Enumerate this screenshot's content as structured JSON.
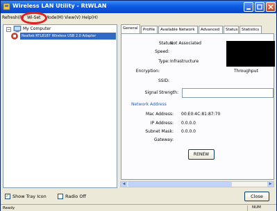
{
  "window": {
    "title": "Wireless LAN Utility - RtWLAN"
  },
  "menu": {
    "items": [
      "Refresh(R)",
      "Wi-Set",
      "Mode(M)",
      "View(V)",
      "Help(H)"
    ]
  },
  "tree": {
    "root_label": "My Computer",
    "adapter_label": "Realtek RTL8187 Wireless USB 2.0 Adapter"
  },
  "tabs": [
    "General",
    "Profile",
    "Available Network",
    "Advanced",
    "Status",
    "Statistics"
  ],
  "general": {
    "status_label": "Status:",
    "status_value": "Not Associated",
    "speed_label": "Speed:",
    "speed_value": "",
    "type_label": "Type:",
    "type_value": "Infrastructure",
    "encryption_label": "Encryption:",
    "encryption_value": "",
    "throughput_label": "Throughput",
    "ssid_label": "SSID:",
    "ssid_value": "",
    "signal_label": "Signal Strength:",
    "network_section": "Network Address",
    "mac_label": "Mac Address:",
    "mac_value": "00:E0:4C:81:87:70",
    "ip_label": "IP Address:",
    "ip_value": "0.0.0.0",
    "subnet_label": "Subnet Mask:",
    "subnet_value": "0.0.0.0",
    "gateway_label": "Gateway:",
    "gateway_value": "",
    "renew_label": "RENEW"
  },
  "bottom": {
    "show_tray_label": "Show Tray Icon",
    "show_tray_checked": true,
    "radio_off_label": "Radio Off",
    "radio_off_checked": false,
    "close_label": "Close"
  },
  "statusbar": {
    "left": "Ready",
    "right": "NUM"
  },
  "colors": {
    "titlebar": "#0b4fd6",
    "selection": "#316ac5",
    "section_title": "#215dc6",
    "annotation_ring": "#e02020"
  },
  "icons": [
    "app-icon",
    "minimize-icon",
    "maximize-icon",
    "close-icon",
    "computer-icon",
    "wireless-adapter-icon",
    "checkmark-icon"
  ]
}
